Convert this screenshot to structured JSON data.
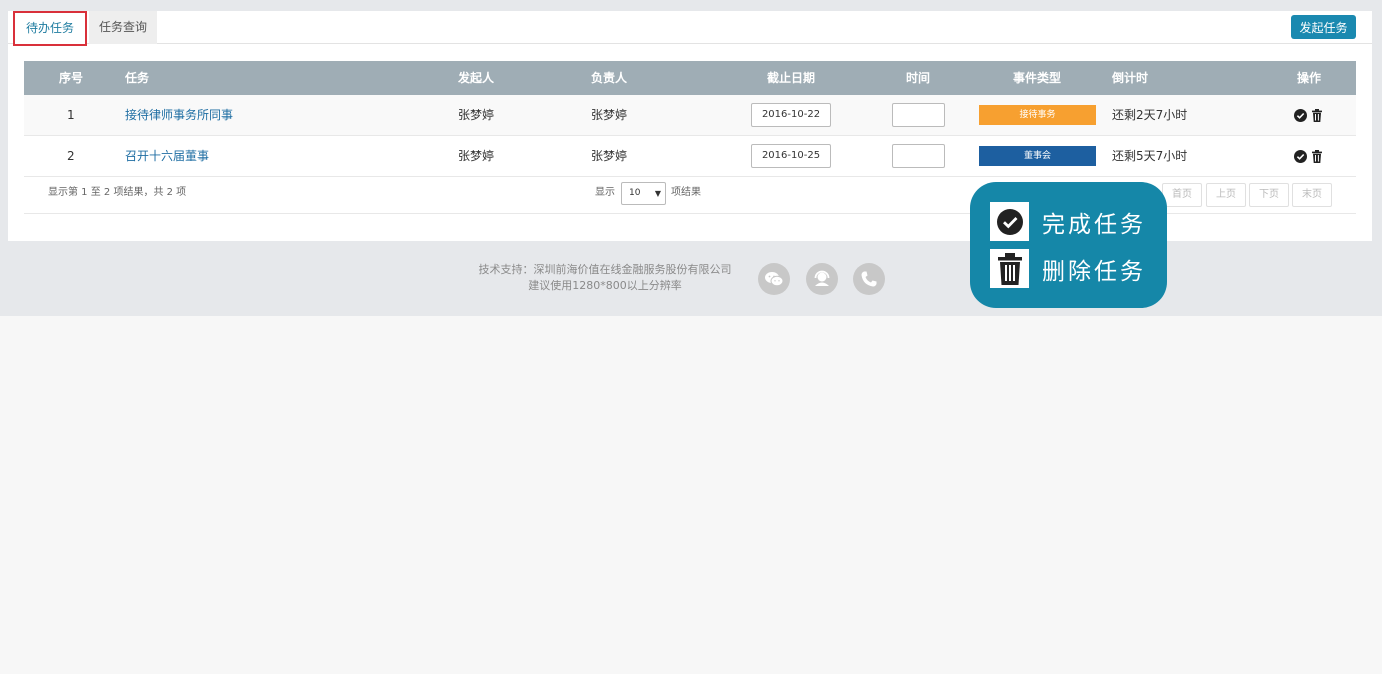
{
  "tabs": [
    {
      "label": "待办任务",
      "active": true
    },
    {
      "label": "任务查询",
      "active": false
    }
  ],
  "toolbar": {
    "start_task_label": "发起任务"
  },
  "table": {
    "columns": [
      "序号",
      "任务",
      "发起人",
      "负责人",
      "截止日期",
      "时间",
      "事件类型",
      "倒计时",
      "操作"
    ],
    "rows": [
      {
        "index": "1",
        "task": "接待律师事务所同事",
        "initiator": "张梦婷",
        "owner": "张梦婷",
        "deadline": "2016-10-22",
        "time": "",
        "event_type": "接待事务",
        "event_color": "#f7a030",
        "countdown": "还剩2天7小时"
      },
      {
        "index": "2",
        "task": "召开十六届董事",
        "initiator": "张梦婷",
        "owner": "张梦婷",
        "deadline": "2016-10-25",
        "time": "",
        "event_type": "董事会",
        "event_color": "#1d5fa0",
        "countdown": "还剩5天7小时"
      }
    ]
  },
  "footer": {
    "info": "显示第 1 至 2 项结果，共 2 项",
    "length_prefix": "显示",
    "length_value": "10",
    "length_suffix": "项结果",
    "pager": [
      "首页",
      "上页",
      "下页",
      "末页"
    ]
  },
  "site_footer": {
    "support": "技术支持：深圳前海价值在线金融服务股份有限公司",
    "recommend": "建议使用1280*800以上分辨率"
  },
  "tooltip": {
    "complete_label": "完成任务",
    "delete_label": "删除任务"
  },
  "colors": {
    "accent": "#1a89b0",
    "header": "#9fadb5",
    "tooltip_bg": "#1587a8"
  }
}
